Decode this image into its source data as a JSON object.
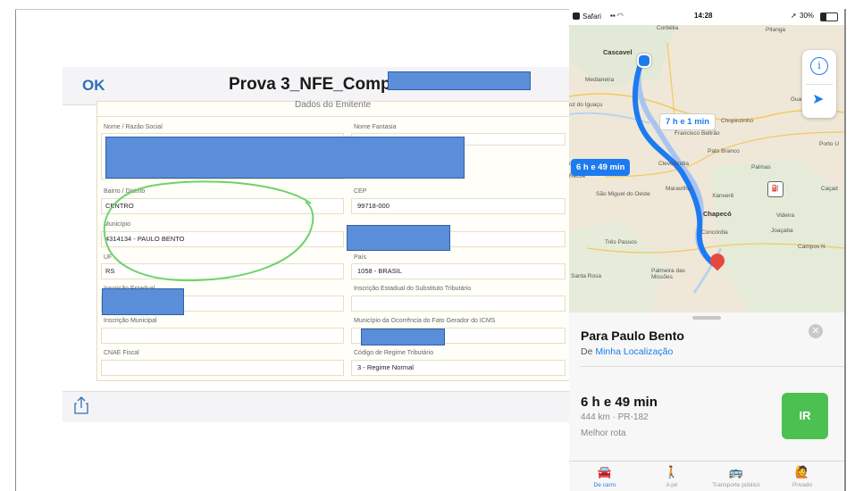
{
  "pdf_viewer": {
    "ok_label": "OK",
    "title": "Prova 3_NFE_Compra",
    "section_title": "Dados do Emitente",
    "fields": {
      "nome_label": "Nome / Razão Social",
      "fantasia_label": "Nome Fantasia",
      "bairro_label": "Bairro / Distrito",
      "bairro_value": "CENTRO",
      "cep_label": "CEP",
      "cep_value": "99718-000",
      "municipio_label": "Município",
      "municipio_value": "4314134 - PAULO BENTO",
      "uf_label": "UF",
      "uf_value": "RS",
      "pais_label": "País",
      "pais_value": "1058 - BRASIL",
      "ie_label": "Inscrição Estadual",
      "ie_st_label": "Inscrição Estadual do Substituto Tributário",
      "im_label": "Inscrição Municipal",
      "municipio_icms_label": "Município da Ocorrência do Fato Gerador do ICMS",
      "cnae_label": "CNAE Fiscal",
      "regime_label": "Código de Regime Tributário",
      "regime_value": "3 - Regime Normal"
    }
  },
  "phone": {
    "status_bar": {
      "carrier": "Safari",
      "time": "14:28",
      "battery": "30%"
    },
    "map": {
      "route_time_main": "6 h e 49 min",
      "route_time_alt": "7 h e 1 min",
      "towns": {
        "cascavel": "Cascavel",
        "corbelia": "Corbélia",
        "medianeira": "Medianeira",
        "iguacu": "oz do Iguaçu",
        "francisco_beltrao": "Francisco Beltrão",
        "pato_branco": "Pato Branco",
        "chopinzinho": "Chopinzinho",
        "palmas": "Palmas",
        "clevelandia": "Clevelândia",
        "maravilha": "Maravilha",
        "xanxere": "Xanxerê",
        "chapeco": "Chapecó",
        "concordia": "Concórdia",
        "videira": "Videira",
        "tres_passos": "Três Passos",
        "santa_rosa": "Santa Rosa",
        "palmeira": "Palmeira das Missões",
        "sao_miguel": "São Miguel do Oeste",
        "joacaba": "Joaçaba",
        "campos_novos": "Campos N",
        "cacador": "Caçad",
        "porto": "Porto U",
        "recife": "Recife",
        "dorado": "dorado",
        "pitanga": "Pitanga",
        "guarapuava": "Gua"
      }
    },
    "sheet": {
      "destination": "Para Paulo Bento",
      "from_prefix": "De ",
      "from_link": "Minha Localização",
      "duration": "6 h e 49 min",
      "distance": "444 km · PR-182",
      "best_route": "Melhor rota",
      "go_label": "IR"
    },
    "tabs": [
      {
        "label": "De carro",
        "active": true
      },
      {
        "label": "A pé",
        "active": false
      },
      {
        "label": "Transporte público",
        "active": false
      },
      {
        "label": "Privado",
        "active": false
      }
    ]
  },
  "colors": {
    "accent_blue": "#1d7bf0",
    "go_green": "#4cc152",
    "redaction": "#5b8ed8",
    "annotation_green": "#6ed26b",
    "pin_red": "#e5483d"
  }
}
